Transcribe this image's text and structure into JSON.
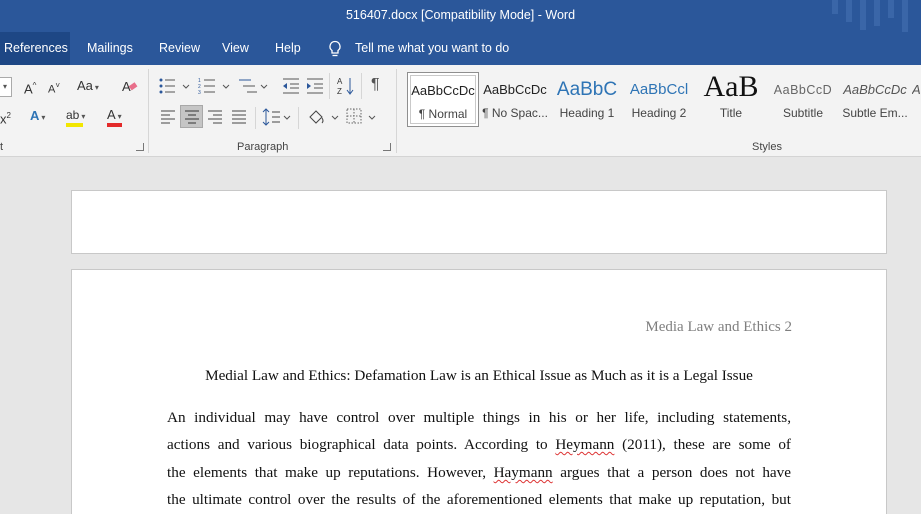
{
  "window": {
    "title": "516407.docx [Compatibility Mode]  -  Word"
  },
  "tabs": [
    "References",
    "Mailings",
    "Review",
    "View",
    "Help"
  ],
  "tell_me": "Tell me what you want to do",
  "ribbon": {
    "font_group_label": "t",
    "paragraph_group_label": "Paragraph",
    "styles_group_label": "Styles",
    "font_tools": {
      "grow": "A",
      "shrink": "A",
      "change_case": "Aa",
      "superscript": "x",
      "superscript_mark": "2",
      "text_effects": "A",
      "highlight": "ab",
      "font_color": "A"
    },
    "colors": {
      "highlight": "#f2e600",
      "font_color": "#e32a2a",
      "accent": "#2b579a"
    },
    "styles": [
      {
        "sample": "AaBbCcDc",
        "name": "¶ Normal"
      },
      {
        "sample": "AaBbCcDc",
        "name": "¶ No Spac..."
      },
      {
        "sample": "AaBbC",
        "name": "Heading 1"
      },
      {
        "sample": "AaBbCcl",
        "name": "Heading 2"
      },
      {
        "sample": "AaB",
        "name": "Title"
      },
      {
        "sample": "AaBbCcD",
        "name": "Subtitle"
      },
      {
        "sample": "AaBbCcDc",
        "name": "Subtle Em..."
      },
      {
        "sample": "A",
        "name": ""
      }
    ]
  },
  "document": {
    "header": "Media Law and Ethics 2",
    "title": "Medial Law and Ethics: Defamation Law is an Ethical Issue as Much as it is a Legal Issue",
    "lines": [
      [
        "An individual may have control over multiple things in his or her life, including statements,"
      ],
      [
        "actions and various biographical data points. According to ",
        "Heymann",
        " (2011), these are some of"
      ],
      [
        "the elements that make up reputations. However, ",
        "Haymann",
        " argues that a person does not have"
      ],
      [
        "the ultimate control over the results of the aforementioned elements that make up reputation, but"
      ]
    ]
  }
}
